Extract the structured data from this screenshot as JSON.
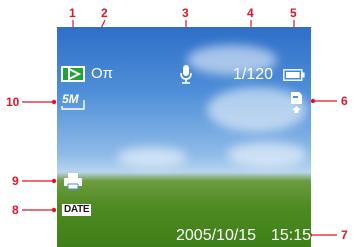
{
  "callouts": [
    "1",
    "2",
    "3",
    "4",
    "5",
    "6",
    "7",
    "8",
    "9",
    "10"
  ],
  "screen": {
    "icons": {
      "mode": "playback-icon",
      "protect": "protect-key-icon",
      "voice": "voice-memo-mic-icon",
      "battery": "battery-full-icon",
      "dpof": "dpof-print-icon",
      "print": "printer-icon"
    },
    "protect_label": "Oπ",
    "file_counter": "1/120",
    "resolution_label": "5M",
    "date_stamp_label": "DATE",
    "date": "2005/10/15",
    "time": "15:15"
  },
  "colors": {
    "callout": "#e0142b",
    "mode_icon": "#22a335"
  }
}
